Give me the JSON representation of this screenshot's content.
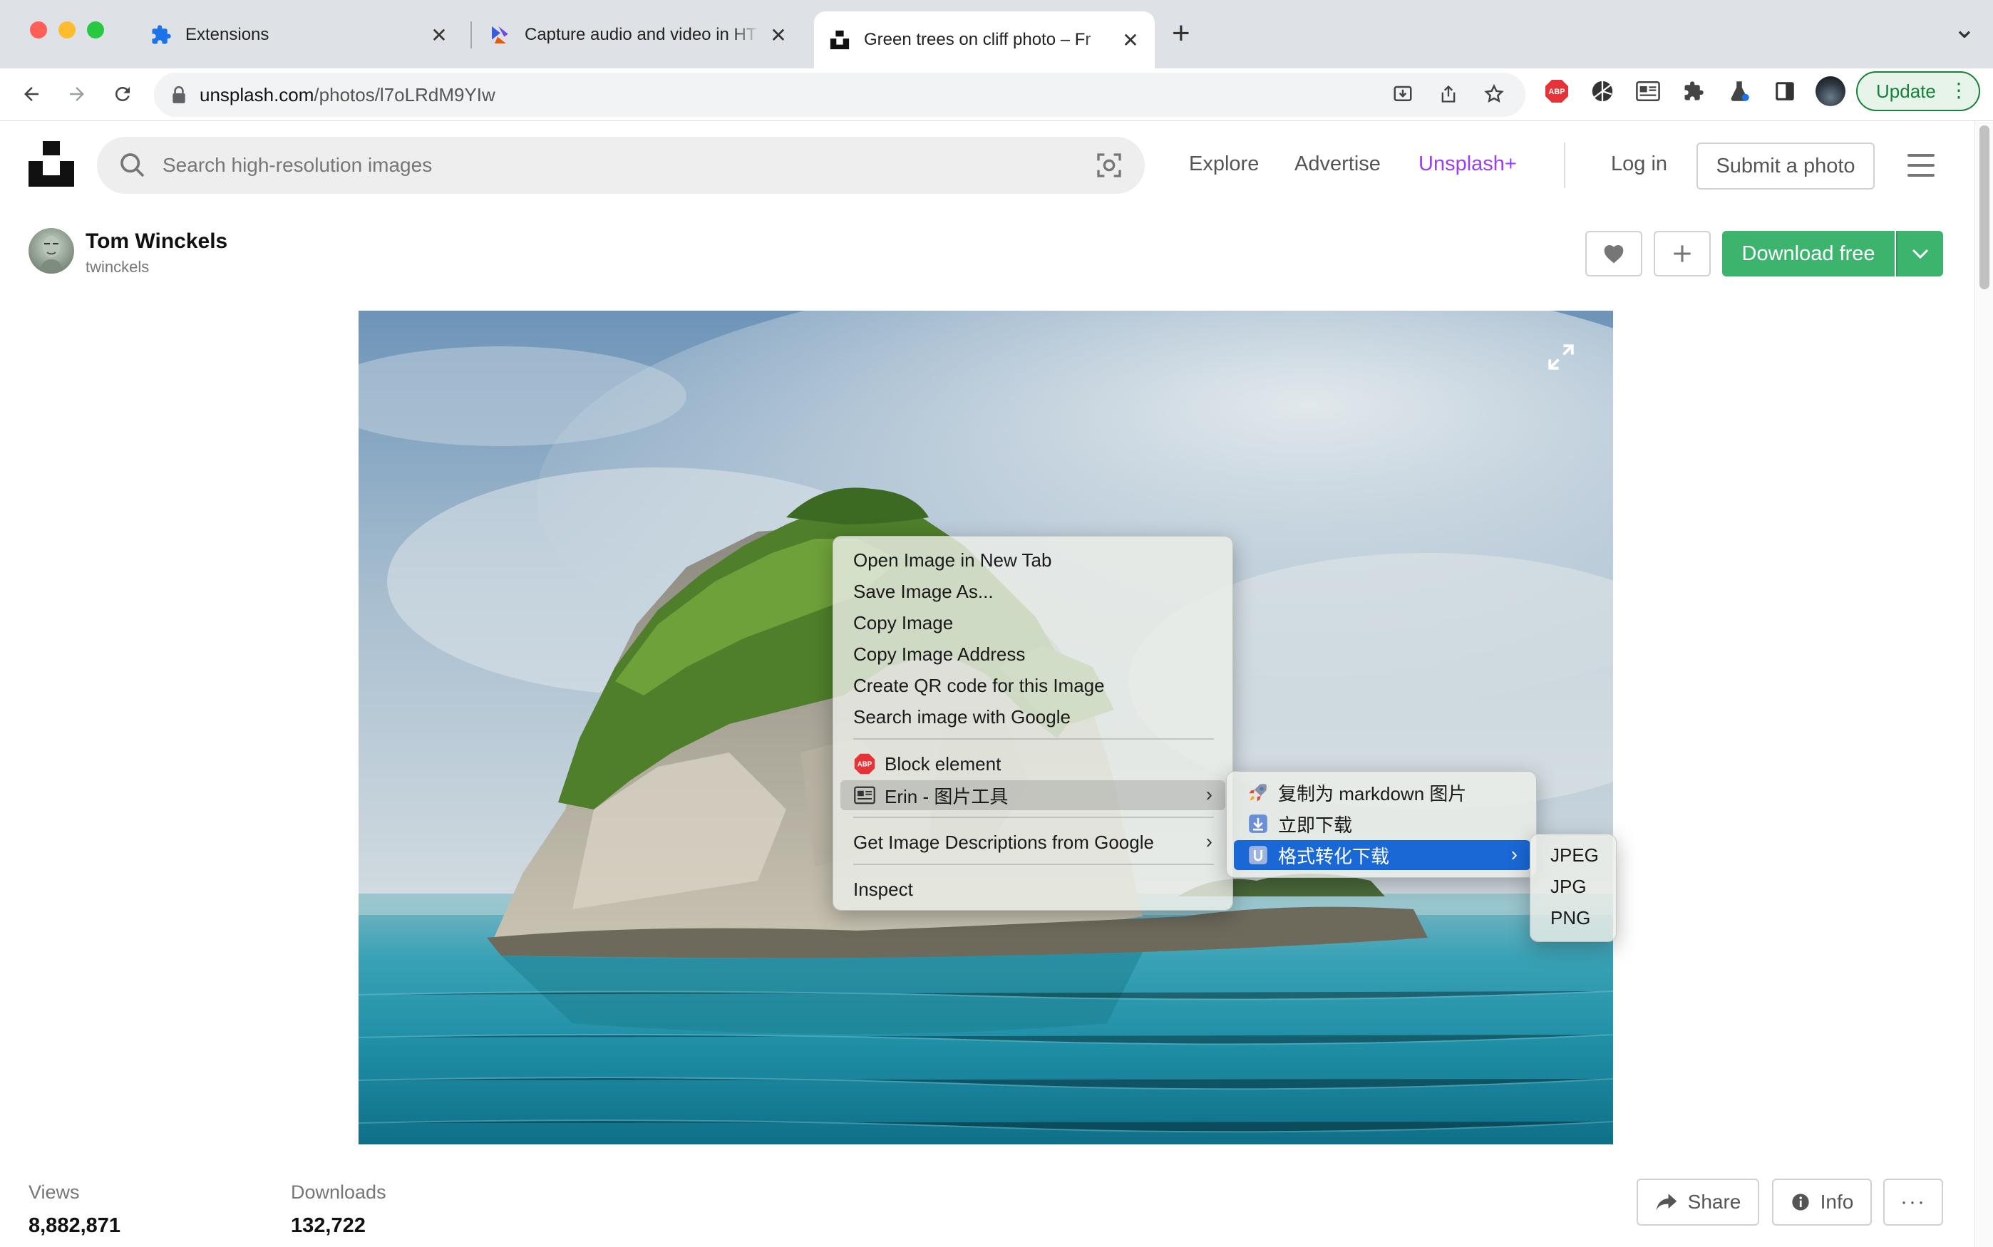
{
  "browser": {
    "tabs": [
      {
        "title": "Extensions",
        "close": "✕"
      },
      {
        "title": "Capture audio and video in HT",
        "close": "✕"
      },
      {
        "title": "Green trees on cliff photo – Fr",
        "close": "✕"
      }
    ],
    "new_tab": "+",
    "tab_list": "⌄",
    "address": {
      "host": "unsplash.com",
      "path": "/photos/l7oLRdM9YIw"
    },
    "update_label": "Update",
    "colors": {
      "close": "#ff5f57",
      "minimize": "#febc2e",
      "zoom": "#28c840",
      "update": "#188038"
    }
  },
  "header": {
    "search_placeholder": "Search high-resolution images",
    "nav": {
      "explore": "Explore",
      "advertise": "Advertise",
      "plus": "Unsplash+",
      "login": "Log in"
    },
    "submit": "Submit a photo",
    "plus_color": "#9b3ff0"
  },
  "author": {
    "name": "Tom Winckels",
    "handle": "twinckels"
  },
  "actions": {
    "like_icon": "heart-icon",
    "add_icon": "plus-icon",
    "download": "Download free",
    "download_color": "#3cb46e"
  },
  "stats": {
    "views_label": "Views",
    "views": "8,882,871",
    "downloads_label": "Downloads",
    "downloads": "132,722"
  },
  "footer_actions": {
    "share": "Share",
    "info": "Info"
  },
  "context_menu": {
    "items": [
      "Open Image in New Tab",
      "Save Image As...",
      "Copy Image",
      "Copy Image Address",
      "Create QR code for this Image",
      "Search image with Google"
    ],
    "block_element": "Block element",
    "erin": "Erin - 图片工具",
    "descriptions": "Get Image Descriptions from Google",
    "inspect": "Inspect"
  },
  "erin_menu": {
    "copy_markdown": "复制为 markdown 图片",
    "download_now": "立即下载",
    "convert_download": "格式转化下载"
  },
  "format_menu": {
    "jpeg": "JPEG",
    "jpg": "JPG",
    "png": "PNG"
  }
}
